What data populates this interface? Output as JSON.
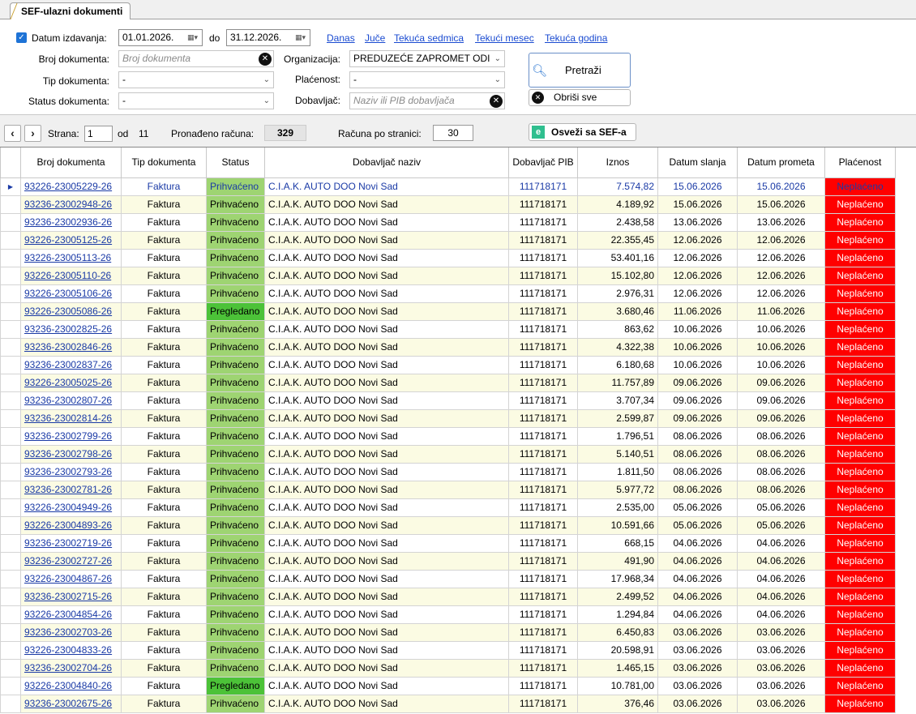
{
  "tab": {
    "label": "SEF-ulazni dokumenti"
  },
  "filters": {
    "date_checkbox_label": "Datum izdavanja:",
    "date_from": "01.01.2026.",
    "date_to_label": "do",
    "date_to": "31.12.2026.",
    "quick_links": [
      "Danas",
      "Juče",
      "Tekuća sedmica",
      "Tekući mesec",
      "Tekuća godina"
    ],
    "broj_label": "Broj dokumenta:",
    "broj_placeholder": "Broj dokumenta",
    "tip_label": "Tip dokumenta:",
    "tip_value": "-",
    "status_label": "Status dokumenta:",
    "status_value": "-",
    "org_label": "Organizacija:",
    "org_value": "PREDUZEĆE ZAPROMET ODI",
    "placenost_label": "Plaćenost:",
    "placenost_value": "-",
    "dobavljac_label": "Dobavljač:",
    "dobavljac_placeholder": "Naziv ili PIB dobavljača",
    "search_button": "Pretraži",
    "clear_button": "Obriši sve"
  },
  "pager": {
    "page_label": "Strana:",
    "page": "1",
    "of_label": "od",
    "total_pages": "11",
    "found_label": "Pronađeno računa:",
    "found": "329",
    "per_page_label": "Računa po stranici:",
    "per_page": "30",
    "refresh_button": "Osveži sa SEF-a"
  },
  "table": {
    "headers": [
      "Broj dokumenta",
      "Tip dokumenta",
      "Status",
      "Dobavljač naziv",
      "Dobavljač PIB",
      "Iznos",
      "Datum slanja",
      "Datum prometa",
      "Plaćenost"
    ],
    "rows": [
      [
        "93226-23005229-26",
        "Faktura",
        "Prihvaćeno",
        "C.I.A.K. AUTO DOO Novi Sad",
        "111718171",
        "7.574,82",
        "15.06.2026",
        "15.06.2026",
        "Neplaćeno"
      ],
      [
        "93236-23002948-26",
        "Faktura",
        "Prihvaćeno",
        "C.I.A.K. AUTO DOO Novi Sad",
        "111718171",
        "4.189,92",
        "15.06.2026",
        "15.06.2026",
        "Neplaćeno"
      ],
      [
        "93236-23002936-26",
        "Faktura",
        "Prihvaćeno",
        "C.I.A.K. AUTO DOO Novi Sad",
        "111718171",
        "2.438,58",
        "13.06.2026",
        "13.06.2026",
        "Neplaćeno"
      ],
      [
        "93226-23005125-26",
        "Faktura",
        "Prihvaćeno",
        "C.I.A.K. AUTO DOO Novi Sad",
        "111718171",
        "22.355,45",
        "12.06.2026",
        "12.06.2026",
        "Neplaćeno"
      ],
      [
        "93226-23005113-26",
        "Faktura",
        "Prihvaćeno",
        "C.I.A.K. AUTO DOO Novi Sad",
        "111718171",
        "53.401,16",
        "12.06.2026",
        "12.06.2026",
        "Neplaćeno"
      ],
      [
        "93226-23005110-26",
        "Faktura",
        "Prihvaćeno",
        "C.I.A.K. AUTO DOO Novi Sad",
        "111718171",
        "15.102,80",
        "12.06.2026",
        "12.06.2026",
        "Neplaćeno"
      ],
      [
        "93226-23005106-26",
        "Faktura",
        "Prihvaćeno",
        "C.I.A.K. AUTO DOO Novi Sad",
        "111718171",
        "2.976,31",
        "12.06.2026",
        "12.06.2026",
        "Neplaćeno"
      ],
      [
        "93226-23005086-26",
        "Faktura",
        "Pregledano",
        "C.I.A.K. AUTO DOO Novi Sad",
        "111718171",
        "3.680,46",
        "11.06.2026",
        "11.06.2026",
        "Neplaćeno"
      ],
      [
        "93236-23002825-26",
        "Faktura",
        "Prihvaćeno",
        "C.I.A.K. AUTO DOO Novi Sad",
        "111718171",
        "863,62",
        "10.06.2026",
        "10.06.2026",
        "Neplaćeno"
      ],
      [
        "93236-23002846-26",
        "Faktura",
        "Prihvaćeno",
        "C.I.A.K. AUTO DOO Novi Sad",
        "111718171",
        "4.322,38",
        "10.06.2026",
        "10.06.2026",
        "Neplaćeno"
      ],
      [
        "93236-23002837-26",
        "Faktura",
        "Prihvaćeno",
        "C.I.A.K. AUTO DOO Novi Sad",
        "111718171",
        "6.180,68",
        "10.06.2026",
        "10.06.2026",
        "Neplaćeno"
      ],
      [
        "93226-23005025-26",
        "Faktura",
        "Prihvaćeno",
        "C.I.A.K. AUTO DOO Novi Sad",
        "111718171",
        "11.757,89",
        "09.06.2026",
        "09.06.2026",
        "Neplaćeno"
      ],
      [
        "93236-23002807-26",
        "Faktura",
        "Prihvaćeno",
        "C.I.A.K. AUTO DOO Novi Sad",
        "111718171",
        "3.707,34",
        "09.06.2026",
        "09.06.2026",
        "Neplaćeno"
      ],
      [
        "93236-23002814-26",
        "Faktura",
        "Prihvaćeno",
        "C.I.A.K. AUTO DOO Novi Sad",
        "111718171",
        "2.599,87",
        "09.06.2026",
        "09.06.2026",
        "Neplaćeno"
      ],
      [
        "93236-23002799-26",
        "Faktura",
        "Prihvaćeno",
        "C.I.A.K. AUTO DOO Novi Sad",
        "111718171",
        "1.796,51",
        "08.06.2026",
        "08.06.2026",
        "Neplaćeno"
      ],
      [
        "93236-23002798-26",
        "Faktura",
        "Prihvaćeno",
        "C.I.A.K. AUTO DOO Novi Sad",
        "111718171",
        "5.140,51",
        "08.06.2026",
        "08.06.2026",
        "Neplaćeno"
      ],
      [
        "93236-23002793-26",
        "Faktura",
        "Prihvaćeno",
        "C.I.A.K. AUTO DOO Novi Sad",
        "111718171",
        "1.811,50",
        "08.06.2026",
        "08.06.2026",
        "Neplaćeno"
      ],
      [
        "93236-23002781-26",
        "Faktura",
        "Prihvaćeno",
        "C.I.A.K. AUTO DOO Novi Sad",
        "111718171",
        "5.977,72",
        "08.06.2026",
        "08.06.2026",
        "Neplaćeno"
      ],
      [
        "93226-23004949-26",
        "Faktura",
        "Prihvaćeno",
        "C.I.A.K. AUTO DOO Novi Sad",
        "111718171",
        "2.535,00",
        "05.06.2026",
        "05.06.2026",
        "Neplaćeno"
      ],
      [
        "93226-23004893-26",
        "Faktura",
        "Prihvaćeno",
        "C.I.A.K. AUTO DOO Novi Sad",
        "111718171",
        "10.591,66",
        "05.06.2026",
        "05.06.2026",
        "Neplaćeno"
      ],
      [
        "93236-23002719-26",
        "Faktura",
        "Prihvaćeno",
        "C.I.A.K. AUTO DOO Novi Sad",
        "111718171",
        "668,15",
        "04.06.2026",
        "04.06.2026",
        "Neplaćeno"
      ],
      [
        "93236-23002727-26",
        "Faktura",
        "Prihvaćeno",
        "C.I.A.K. AUTO DOO Novi Sad",
        "111718171",
        "491,90",
        "04.06.2026",
        "04.06.2026",
        "Neplaćeno"
      ],
      [
        "93226-23004867-26",
        "Faktura",
        "Prihvaćeno",
        "C.I.A.K. AUTO DOO Novi Sad",
        "111718171",
        "17.968,34",
        "04.06.2026",
        "04.06.2026",
        "Neplaćeno"
      ],
      [
        "93236-23002715-26",
        "Faktura",
        "Prihvaćeno",
        "C.I.A.K. AUTO DOO Novi Sad",
        "111718171",
        "2.499,52",
        "04.06.2026",
        "04.06.2026",
        "Neplaćeno"
      ],
      [
        "93226-23004854-26",
        "Faktura",
        "Prihvaćeno",
        "C.I.A.K. AUTO DOO Novi Sad",
        "111718171",
        "1.294,84",
        "04.06.2026",
        "04.06.2026",
        "Neplaćeno"
      ],
      [
        "93236-23002703-26",
        "Faktura",
        "Prihvaćeno",
        "C.I.A.K. AUTO DOO Novi Sad",
        "111718171",
        "6.450,83",
        "03.06.2026",
        "03.06.2026",
        "Neplaćeno"
      ],
      [
        "93226-23004833-26",
        "Faktura",
        "Prihvaćeno",
        "C.I.A.K. AUTO DOO Novi Sad",
        "111718171",
        "20.598,91",
        "03.06.2026",
        "03.06.2026",
        "Neplaćeno"
      ],
      [
        "93236-23002704-26",
        "Faktura",
        "Prihvaćeno",
        "C.I.A.K. AUTO DOO Novi Sad",
        "111718171",
        "1.465,15",
        "03.06.2026",
        "03.06.2026",
        "Neplaćeno"
      ],
      [
        "93226-23004840-26",
        "Faktura",
        "Pregledano",
        "C.I.A.K. AUTO DOO Novi Sad",
        "111718171",
        "10.781,00",
        "03.06.2026",
        "03.06.2026",
        "Neplaćeno"
      ],
      [
        "93236-23002675-26",
        "Faktura",
        "Prihvaćeno",
        "C.I.A.K. AUTO DOO Novi Sad",
        "111718171",
        "376,46",
        "03.06.2026",
        "03.06.2026",
        "Neplaćeno"
      ]
    ]
  }
}
